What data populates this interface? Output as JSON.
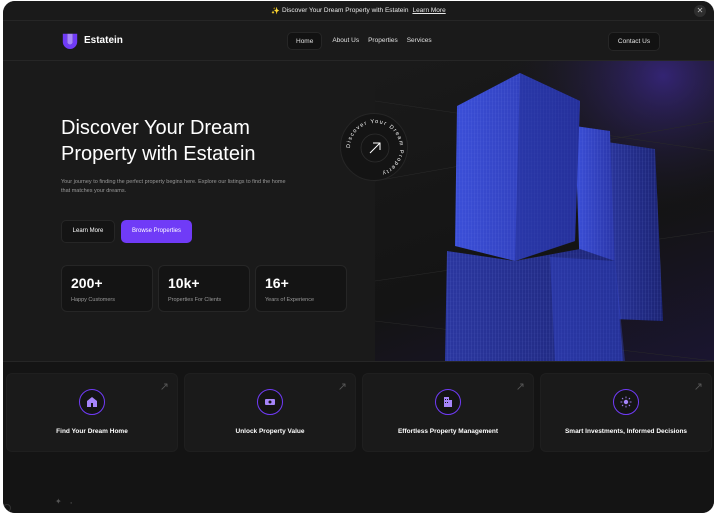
{
  "announcement": {
    "text": "Discover Your Dream Property with Estatein",
    "link": "Learn More"
  },
  "header": {
    "brand": "Estatein",
    "nav": [
      "Home",
      "About Us",
      "Properties",
      "Services"
    ],
    "active_nav": "Home",
    "contact": "Contact Us"
  },
  "hero": {
    "title_line1": "Discover Your Dream",
    "title_line2": "Property with Estatein",
    "description_line1": "Your journey to finding the perfect property begins here. Explore our listings to find the home",
    "description_line2": "that matches your dreams.",
    "btn_learn": "Learn More",
    "btn_browse": "Browse Properties",
    "badge_text": "Discover Your Dream Property",
    "stats": [
      {
        "value": "200+",
        "label": "Happy Customers"
      },
      {
        "value": "10k+",
        "label": "Properties For Clients"
      },
      {
        "value": "16+",
        "label": "Years of Experience"
      }
    ]
  },
  "features": [
    {
      "title": "Find Your Dream Home",
      "icon": "home-icon"
    },
    {
      "title": "Unlock Property Value",
      "icon": "cash-icon"
    },
    {
      "title": "Effortless Property Management",
      "icon": "building-icon"
    },
    {
      "title": "Smart Investments, Informed Decisions",
      "icon": "sun-icon"
    }
  ],
  "colors": {
    "accent": "#703bf7",
    "background": "#141414",
    "surface": "#1a1a1a",
    "border": "#262626",
    "text_muted": "#999999"
  }
}
